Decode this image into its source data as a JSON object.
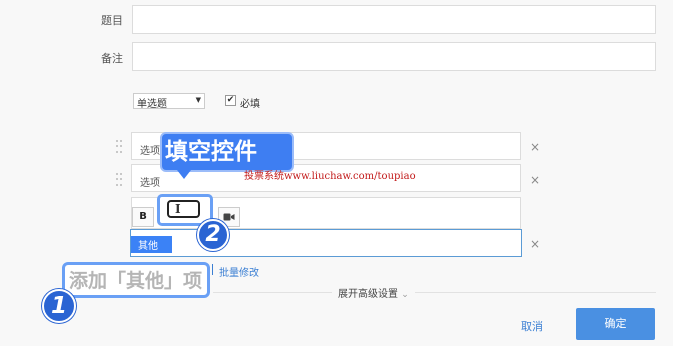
{
  "form": {
    "title_label": "题目",
    "note_label": "备注",
    "type_select": "单选题",
    "type_arrow": "▼",
    "required_label": "必填",
    "options": [
      "选项",
      "选项"
    ],
    "other_option_text": "其他",
    "close_glyph": "×",
    "toolbar": {
      "bold": "B"
    },
    "batch_edit_link": "批量修改",
    "advanced_settings": "展开高级设置",
    "cancel": "取消",
    "confirm": "确定"
  },
  "annotations": {
    "fill_blank_callout": "填空控件",
    "badge_two": "2",
    "add_other_callout": "添加「其他」项",
    "badge_one": "1",
    "text_cursor_glyph": "I"
  },
  "watermark": "投票系统www.liuchaw.com/toupiao",
  "colors": {
    "accent": "#3e7ef2",
    "primary_button": "#4a90e2",
    "watermark": "#c21a1a"
  }
}
